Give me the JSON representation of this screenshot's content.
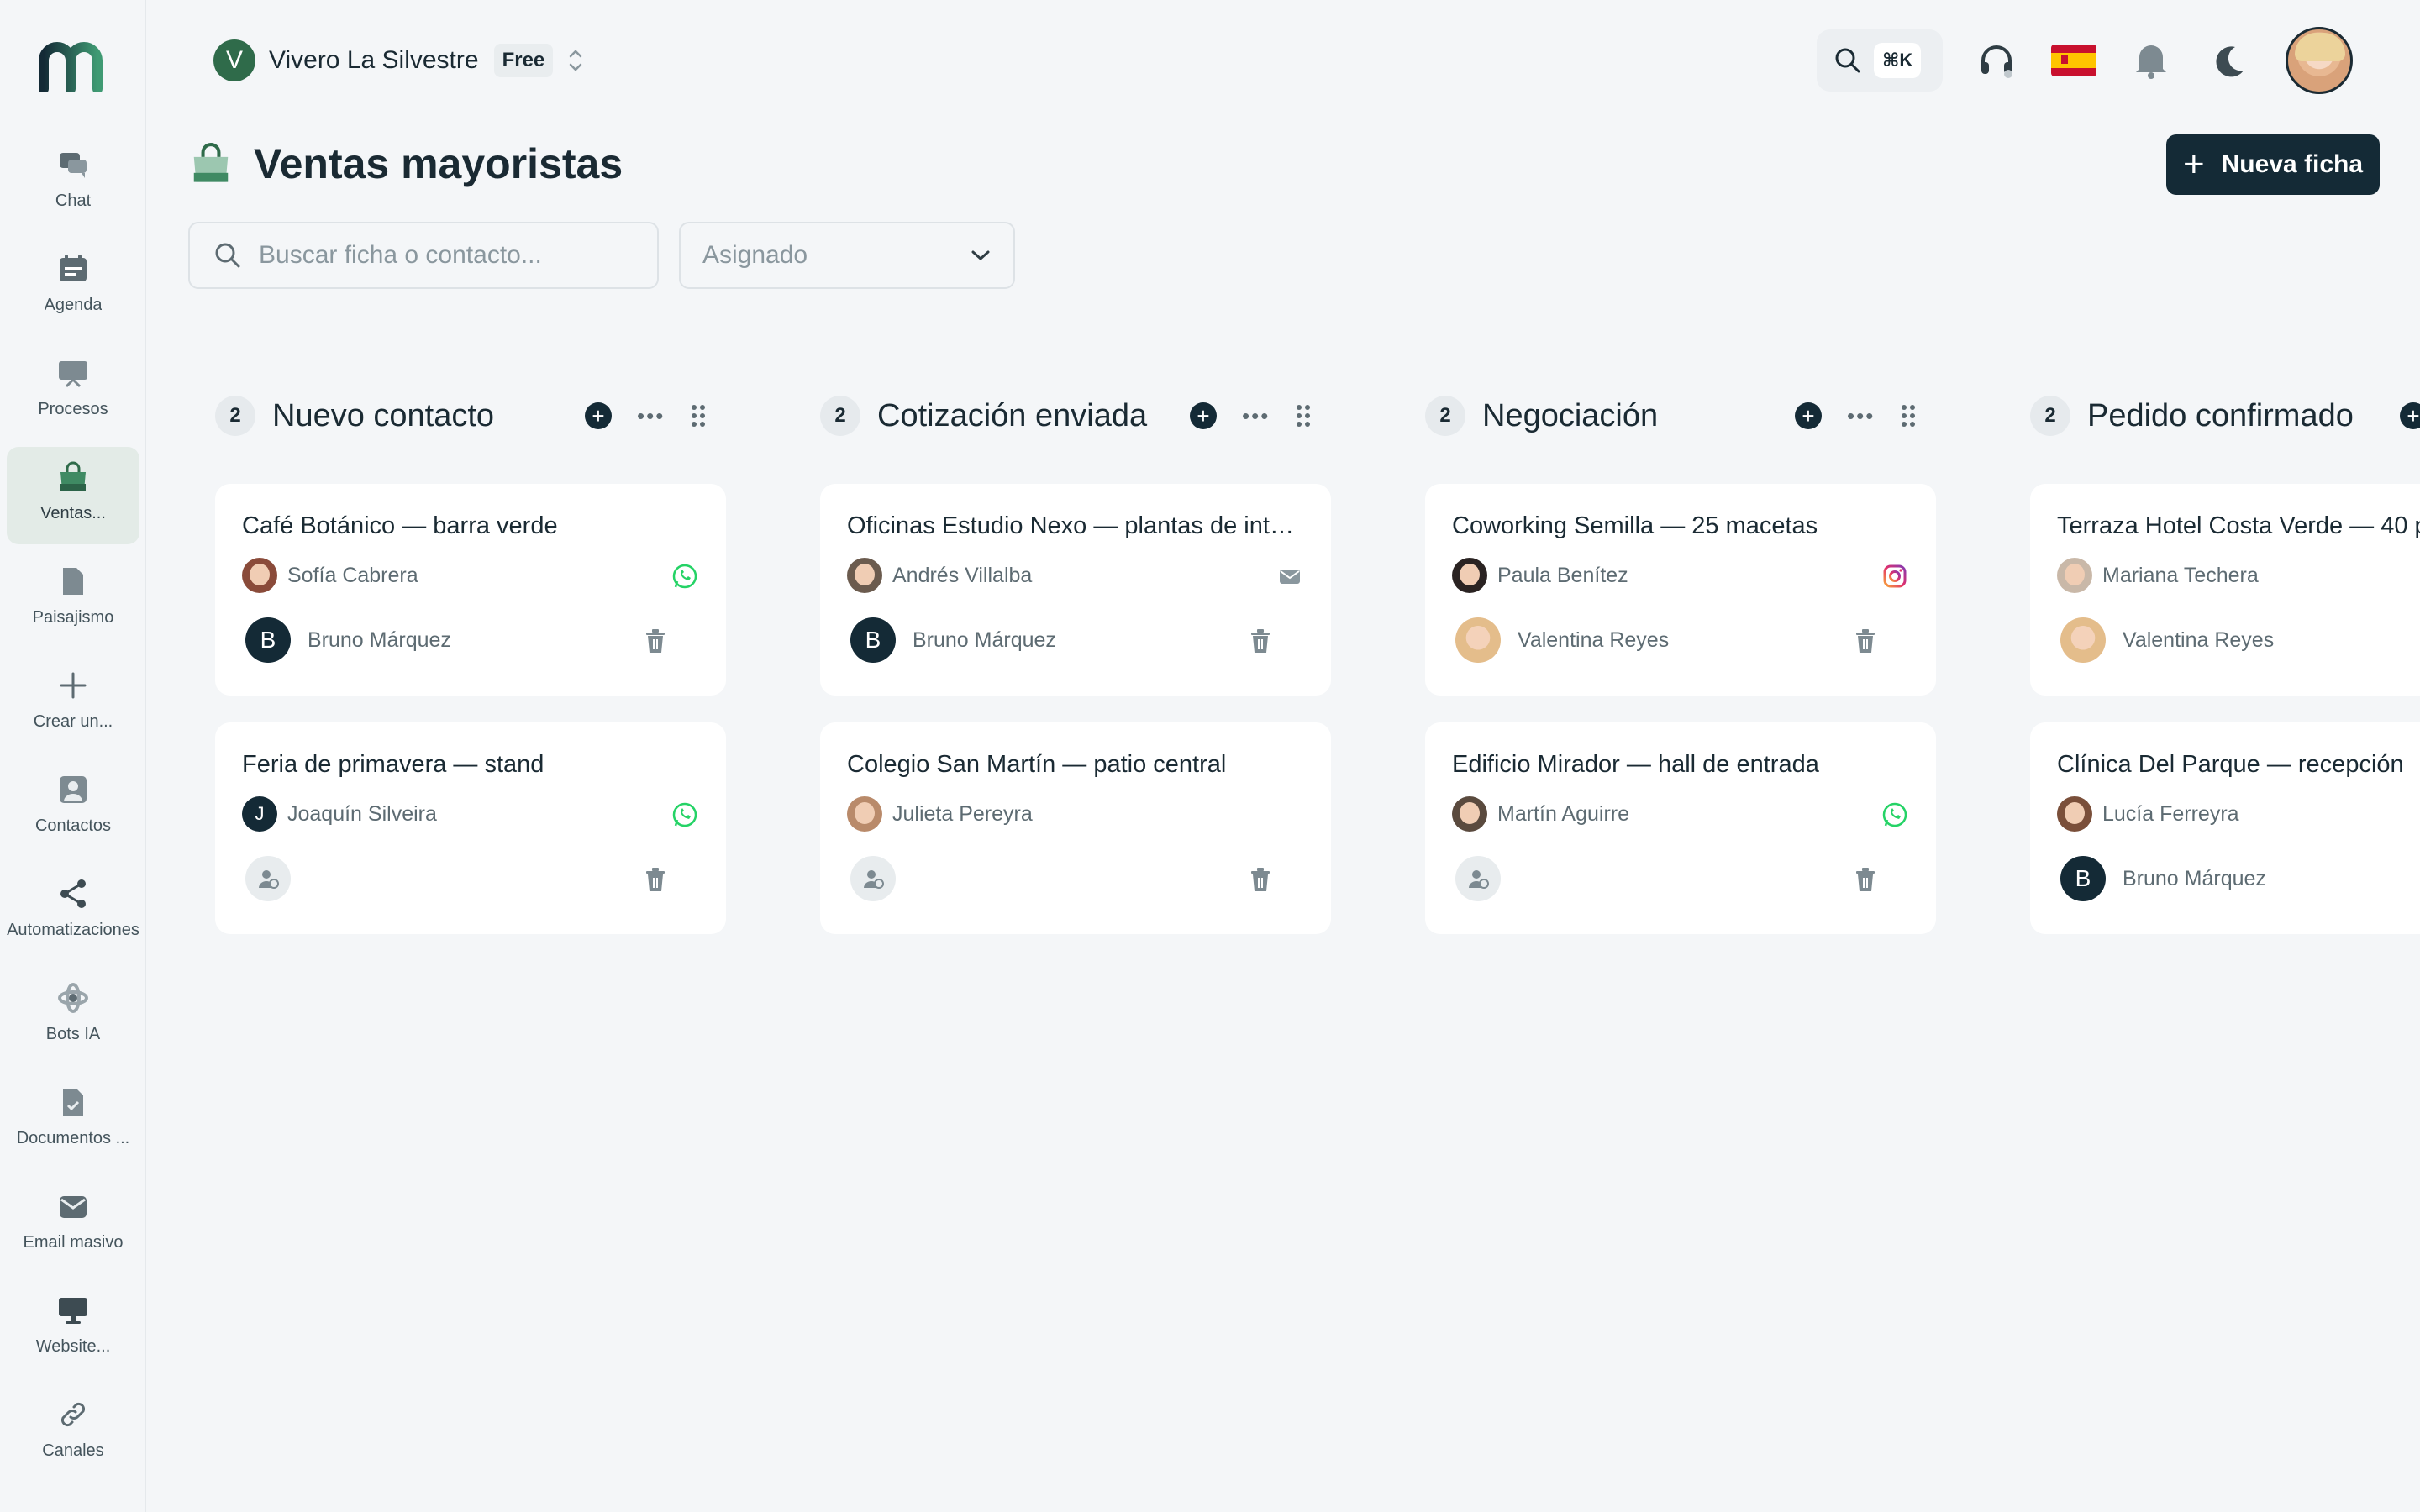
{
  "workspace": {
    "initial": "V",
    "name": "Vivero La Silvestre",
    "plan": "Free"
  },
  "header": {
    "shortcut": "⌘K"
  },
  "sidebar": {
    "items": [
      {
        "label": "Chat",
        "icon": "chat-icon"
      },
      {
        "label": "Agenda",
        "icon": "calendar-icon"
      },
      {
        "label": "Procesos",
        "icon": "board-icon"
      },
      {
        "label": "Ventas...",
        "icon": "shopping-bag-icon",
        "active": true
      },
      {
        "label": "Paisajismo",
        "icon": "file-icon"
      },
      {
        "label": "Crear un...",
        "icon": "plus-icon"
      },
      {
        "label": "Contactos",
        "icon": "contact-icon"
      },
      {
        "label": "Automatizaciones",
        "icon": "share-icon"
      },
      {
        "label": "Bots IA",
        "icon": "bot-icon"
      },
      {
        "label": "Documentos ...",
        "icon": "document-icon"
      },
      {
        "label": "Email masivo",
        "icon": "mail-icon"
      },
      {
        "label": "Website...",
        "icon": "monitor-icon"
      },
      {
        "label": "Canales",
        "icon": "link-icon"
      }
    ]
  },
  "page": {
    "title": "Ventas mayoristas",
    "new_button": "Nueva ficha",
    "search_placeholder": "Buscar ficha o contacto...",
    "assigned_filter": "Asignado"
  },
  "columns": [
    {
      "count": "2",
      "title": "Nuevo contacto",
      "cards": [
        {
          "title": "Café Botánico — barra verde",
          "contact": "Sofía Cabrera",
          "channel": "whatsapp",
          "assignee": "Bruno Márquez",
          "assignee_initial": "B"
        },
        {
          "title": "Feria de primavera — stand",
          "contact": "Joaquín Silveira",
          "contact_initial": "J",
          "channel": "whatsapp",
          "assignee": ""
        }
      ]
    },
    {
      "count": "2",
      "title": "Cotización enviada",
      "cards": [
        {
          "title": "Oficinas Estudio Nexo — plantas de interior",
          "contact": "Andrés Villalba",
          "channel": "email",
          "assignee": "Bruno Márquez",
          "assignee_initial": "B"
        },
        {
          "title": "Colegio San Martín — patio central",
          "contact": "Julieta Pereyra",
          "channel": "",
          "assignee": ""
        }
      ]
    },
    {
      "count": "2",
      "title": "Negociación",
      "cards": [
        {
          "title": "Coworking Semilla — 25 macetas",
          "contact": "Paula Benítez",
          "channel": "instagram",
          "assignee": "Valentina Reyes"
        },
        {
          "title": "Edificio Mirador — hall de entrada",
          "contact": "Martín Aguirre",
          "channel": "whatsapp",
          "assignee": ""
        }
      ]
    },
    {
      "count": "2",
      "title": "Pedido confirmado",
      "cards": [
        {
          "title": "Terraza Hotel Costa Verde — 40 p",
          "contact": "Mariana Techera",
          "channel": "",
          "assignee": "Valentina Reyes"
        },
        {
          "title": "Clínica Del Parque — recepción",
          "contact": "Lucía Ferreyra",
          "channel": "",
          "assignee": "Bruno Márquez",
          "assignee_initial": "B"
        }
      ]
    }
  ],
  "colors": {
    "brand": "#142a36",
    "accent_green": "#2f6b4a",
    "whatsapp": "#25d366"
  }
}
